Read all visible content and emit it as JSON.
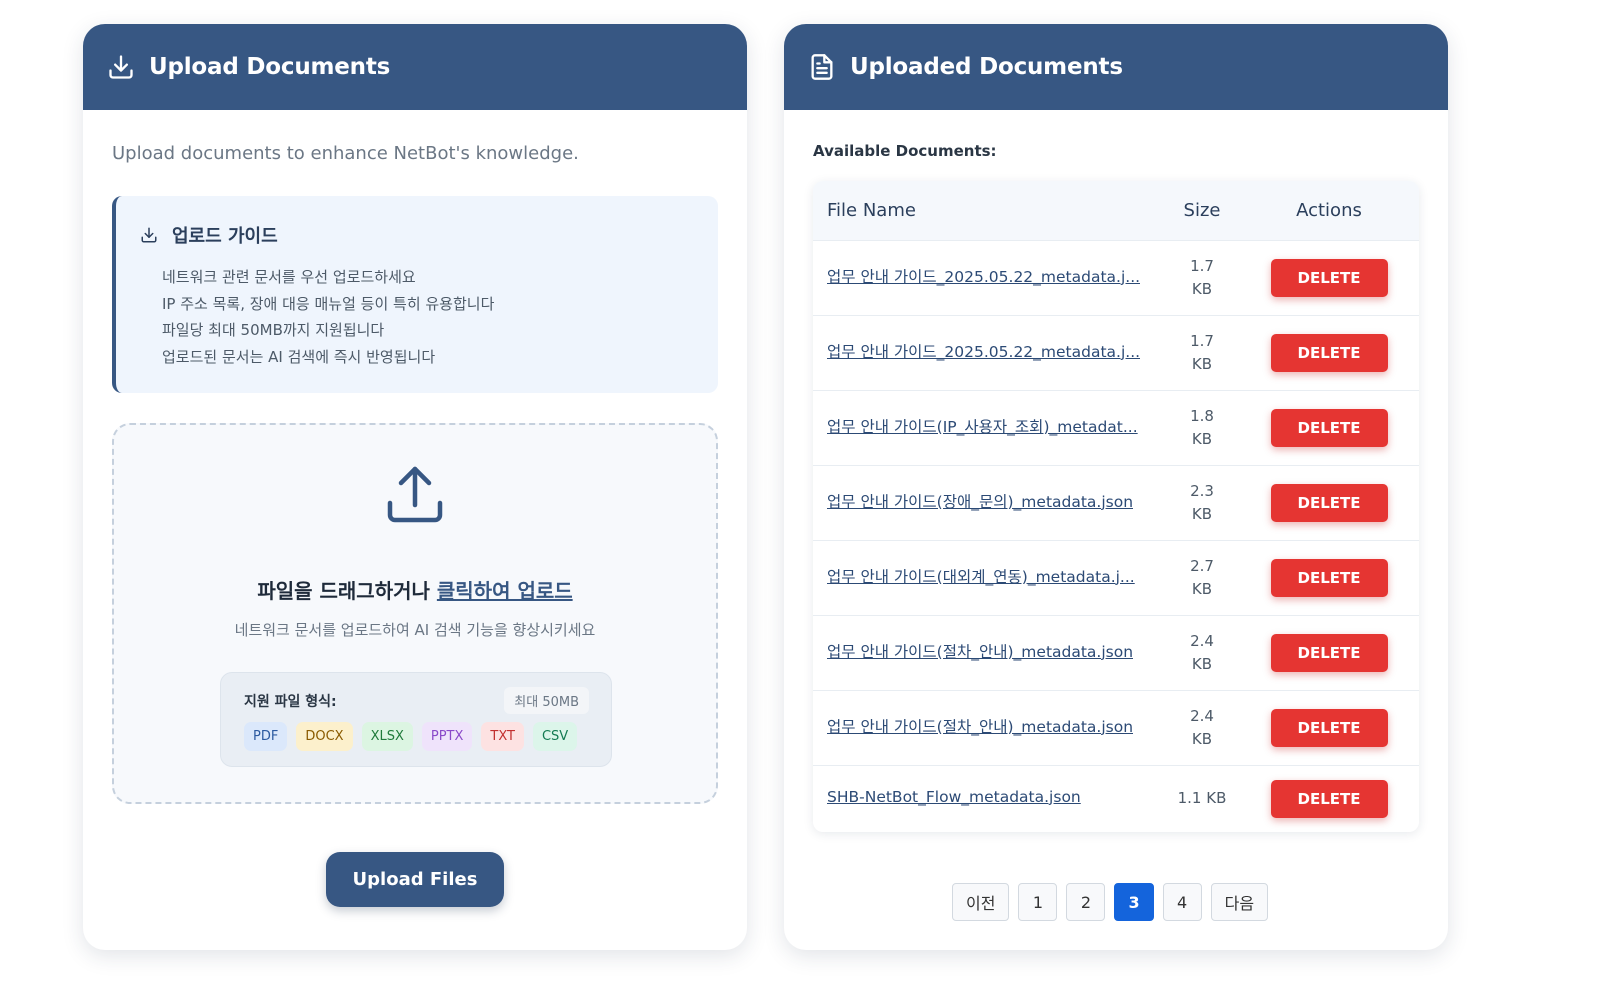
{
  "upload_panel": {
    "title": "Upload Documents",
    "intro": "Upload documents to enhance NetBot's knowledge.",
    "guide": {
      "title": "업로드 가이드",
      "items": [
        "네트워크 관련 문서를 우선 업로드하세요",
        "IP 주소 목록, 장애 대응 매뉴얼 등이 특히 유용합니다",
        "파일당 최대 50MB까지 지원됩니다",
        "업로드된 문서는 AI 검색에 즉시 반영됩니다"
      ]
    },
    "dropzone": {
      "title_prefix": "파일을 드래그하거나 ",
      "title_link": "클릭하여 업로드",
      "subtitle": "네트워크 문서를 업로드하여 AI 검색 기능을 향상시키세요",
      "formats_label": "지원 파일 형식:",
      "max_size": "최대 50MB",
      "formats": [
        "PDF",
        "DOCX",
        "XLSX",
        "PPTX",
        "TXT",
        "CSV"
      ]
    },
    "upload_button": "Upload Files"
  },
  "documents_panel": {
    "title": "Uploaded Documents",
    "available_label": "Available Documents:",
    "columns": {
      "name": "File Name",
      "size": "Size",
      "actions": "Actions"
    },
    "rows": [
      {
        "name": "업무 안내 가이드_2025.05.22_metadata.j...",
        "size_value": "1.7",
        "size_unit": "KB"
      },
      {
        "name": "업무 안내 가이드_2025.05.22_metadata.j...",
        "size_value": "1.7",
        "size_unit": "KB"
      },
      {
        "name": "업무 안내 가이드(IP_사용자_조회)_metadat...",
        "size_value": "1.8",
        "size_unit": "KB"
      },
      {
        "name": "업무 안내 가이드(장애_문의)_metadata.json",
        "size_value": "2.3",
        "size_unit": "KB"
      },
      {
        "name": "업무 안내 가이드(대외계_연동)_metadata.j...",
        "size_value": "2.7",
        "size_unit": "KB"
      },
      {
        "name": "업무 안내 가이드(절차_안내)_metadata.json",
        "size_value": "2.4",
        "size_unit": "KB"
      },
      {
        "name": "업무 안내 가이드(절차_안내)_metadata.json",
        "size_value": "2.4",
        "size_unit": "KB"
      },
      {
        "name": "SHB-NetBot_Flow_metadata.json",
        "size_value": "1.1 KB",
        "size_unit": ""
      }
    ],
    "delete_label": "DELETE",
    "pagination": {
      "prev": "이전",
      "pages": [
        "1",
        "2",
        "3",
        "4"
      ],
      "current": "3",
      "next": "다음"
    }
  },
  "colors": {
    "header": "#375783",
    "delete": "#e53532",
    "active_page": "#1464dc"
  },
  "icons": {
    "upload_header": "download-icon",
    "documents_header": "document-icon",
    "guide": "download-icon",
    "dropzone": "upload-icon"
  }
}
